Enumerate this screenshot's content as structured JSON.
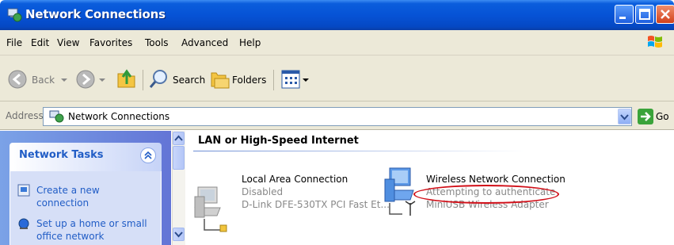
{
  "window": {
    "title": "Network Connections",
    "controls": [
      "minimize",
      "maximize",
      "close"
    ]
  },
  "menu": [
    "File",
    "Edit",
    "View",
    "Favorites",
    "Tools",
    "Advanced",
    "Help"
  ],
  "toolbar": {
    "back_label": "Back",
    "search_label": "Search",
    "folders_label": "Folders"
  },
  "address": {
    "label": "Address",
    "value": "Network Connections",
    "go_label": "Go"
  },
  "tasks": {
    "title": "Network Tasks",
    "items": [
      {
        "label": "Create a new connection",
        "line1": "Create a new",
        "line2": "connection"
      },
      {
        "label": "Set up a home or small office network",
        "line1": "Set up a home or small",
        "line2": "office network"
      }
    ]
  },
  "main": {
    "group_title": "LAN or High-Speed Internet",
    "connections": [
      {
        "name": "Local Area Connection",
        "status": "Disabled",
        "device": "D-Link DFE-530TX PCI Fast Et..."
      },
      {
        "name": "Wireless Network Connection",
        "status": "Attempting to authenticate",
        "device": "MiniUSB Wireless Adapter"
      }
    ]
  },
  "colors": {
    "titlebar": "#0653d6",
    "task_pane": "#6f8de0",
    "task_link": "#215dc6",
    "annotation": "#d10f18"
  }
}
